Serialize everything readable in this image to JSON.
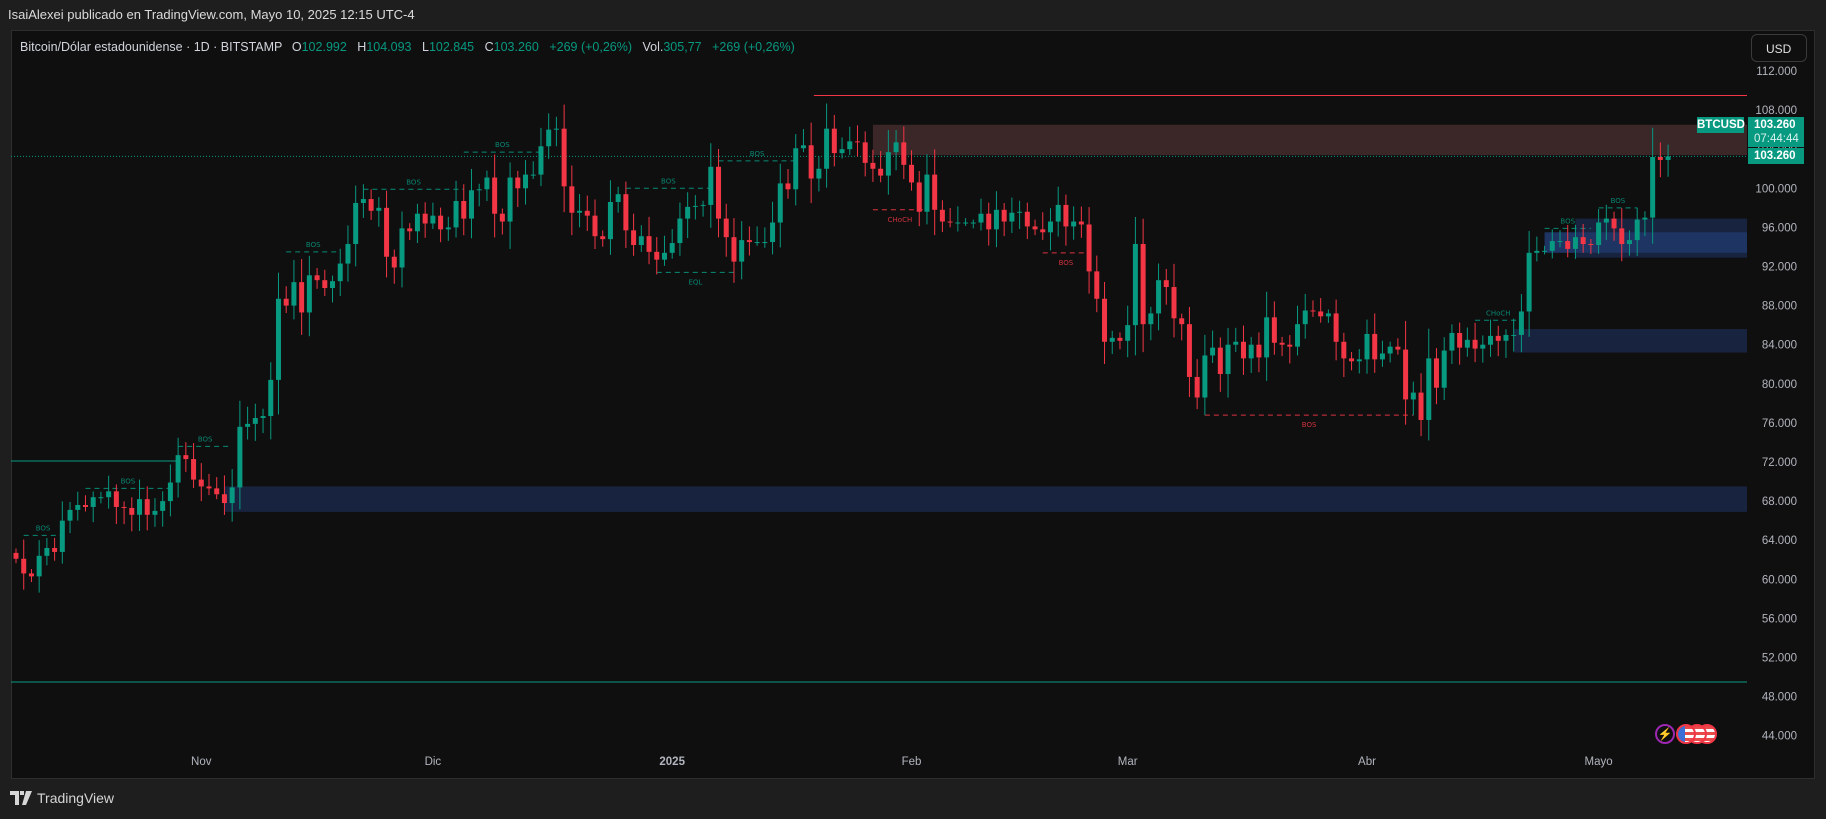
{
  "header": {
    "publisher_line": "IsaiAlexei publicado en TradingView.com, Mayo 10, 2025 12:15 UTC-4"
  },
  "legend": {
    "symbol": "Bitcoin/Dólar estadounidense · 1D · BITSTAMP",
    "o_label": "O",
    "o": "102.992",
    "h_label": "H",
    "h": "104.093",
    "l_label": "L",
    "l": "102.845",
    "c_label": "C",
    "c": "103.260",
    "change": "+269 (+0,26%)",
    "vol_label": "Vol.",
    "vol": "305,77",
    "vol_change": "+269 (+0,26%)"
  },
  "currency_button": "USD",
  "price_tag": {
    "symbol": "BTCUSD",
    "price": "103.260",
    "countdown": "07:44:44",
    "price2": "103.260"
  },
  "footer": {
    "brand": "TradingView"
  },
  "colors": {
    "up": "#089981",
    "down": "#f23645",
    "supply": "#3b2628",
    "demand": "#18243f",
    "demand_light": "#1e3462",
    "bg": "#0f0f0f"
  },
  "icons": [
    "lightning-event-icon",
    "us-flag-event-icon",
    "us-flag-event-icon",
    "us-flag-event-icon"
  ],
  "chart_data": {
    "type": "candlestick",
    "symbol": "BTCUSD",
    "interval": "1D",
    "start_date": "2024-10-08",
    "first_open": 62.7,
    "unit": "thousand USD",
    "closes": [
      62.1,
      60.6,
      60.3,
      62.4,
      63.2,
      62.8,
      66.0,
      67.1,
      67.6,
      67.4,
      68.4,
      68.4,
      69.0,
      67.4,
      67.3,
      66.6,
      68.2,
      66.6,
      67.0,
      68.0,
      69.9,
      72.7,
      72.3,
      70.2,
      69.5,
      69.3,
      68.7,
      67.8,
      69.4,
      75.6,
      75.9,
      76.5,
      76.7,
      80.4,
      88.7,
      88.0,
      90.4,
      87.3,
      91.1,
      90.6,
      89.8,
      90.5,
      92.3,
      94.3,
      98.5,
      98.9,
      97.7,
      98.0,
      93.0,
      91.9,
      95.9,
      95.6,
      97.4,
      96.4,
      97.2,
      95.8,
      96.0,
      98.7,
      96.9,
      99.8,
      99.9,
      101.1,
      97.4,
      96.6,
      101.1,
      100.0,
      101.4,
      101.4,
      104.3,
      106.0,
      106.1,
      100.2,
      97.5,
      97.7,
      97.2,
      95.1,
      94.8,
      98.6,
      99.4,
      95.7,
      94.2,
      95.1,
      93.5,
      92.7,
      93.4,
      94.4,
      96.9,
      98.1,
      98.2,
      98.3,
      102.2,
      96.9,
      95.0,
      92.5,
      94.7,
      94.5,
      94.5,
      94.5,
      96.5,
      100.5,
      99.9,
      104.1,
      104.4,
      101.0,
      102.0,
      106.1,
      103.6,
      104.0,
      104.8,
      104.7,
      102.6,
      102.0,
      101.3,
      103.7,
      104.7,
      102.4,
      100.6,
      97.6,
      101.4,
      97.8,
      96.6,
      96.5,
      96.5,
      96.5,
      96.5,
      97.4,
      95.8,
      97.8,
      96.6,
      97.5,
      97.6,
      96.1,
      95.8,
      95.5,
      96.6,
      98.3,
      96.1,
      96.6,
      96.3,
      91.5,
      88.7,
      84.3,
      84.7,
      84.4,
      86.0,
      94.3,
      86.1,
      87.2,
      90.6,
      89.9,
      86.7,
      86.1,
      80.7,
      78.6,
      82.9,
      83.7,
      81.0,
      84.0,
      84.3,
      82.6,
      84.0,
      82.7,
      86.8,
      84.2,
      84.0,
      83.8,
      86.1,
      87.5,
      87.4,
      86.9,
      87.2,
      84.3,
      82.6,
      82.3,
      82.5,
      85.1,
      82.5,
      83.1,
      83.8,
      83.5,
      78.4,
      79.1,
      76.3,
      82.6,
      79.6,
      83.4,
      85.2,
      83.7,
      84.5,
      83.6,
      84.0,
      84.9,
      84.4,
      85.0,
      85.0,
      87.4,
      93.4,
      93.6,
      93.6,
      94.6,
      94.6,
      93.8,
      95.0,
      94.3,
      94.2,
      96.5,
      96.9,
      95.9,
      94.3,
      94.7,
      96.8,
      97.0,
      103.2,
      102.9,
      103.26
    ],
    "y_ticks": [
      "112.000",
      "108.000",
      "104.000",
      "100.000",
      "96.000",
      "92.000",
      "88.000",
      "84.000",
      "80.000",
      "76.000",
      "72.000",
      "68.000",
      "64.000",
      "60.000",
      "56.000",
      "52.000",
      "48.000",
      "44.000"
    ],
    "y_tick_values": [
      112,
      108,
      104,
      100,
      96,
      92,
      88,
      84,
      80,
      76,
      72,
      68,
      64,
      60,
      56,
      52,
      48,
      44
    ],
    "ylim": [
      44,
      112
    ],
    "x_ticks": [
      {
        "label": "Nov",
        "date": "2024-11-01"
      },
      {
        "label": "Dic",
        "date": "2024-12-01"
      },
      {
        "label": "2025",
        "date": "2025-01-01"
      },
      {
        "label": "Feb",
        "date": "2025-02-01"
      },
      {
        "label": "Mar",
        "date": "2025-03-01"
      },
      {
        "label": "Abr",
        "date": "2025-04-01"
      },
      {
        "label": "Mayo",
        "date": "2025-05-01"
      }
    ],
    "last_price": 103.26,
    "zones": [
      {
        "kind": "supply",
        "from": "2025-01-27",
        "low": 103.4,
        "high": 106.5
      },
      {
        "kind": "demand",
        "from": "2025-04-28",
        "low": 92.9,
        "high": 96.9
      },
      {
        "kind": "demand_light",
        "from": "2025-04-24",
        "low": 93.4,
        "high": 95.5
      },
      {
        "kind": "demand",
        "from": "2025-04-20",
        "low": 83.2,
        "high": 85.6
      },
      {
        "kind": "demand",
        "from": "2024-11-04",
        "low": 66.9,
        "high": 69.5
      }
    ],
    "levels": [
      {
        "color": "#f23645",
        "from": "2025-01-20",
        "price": 109.5
      },
      {
        "color": "#089981",
        "from": "2024-10-08",
        "to": "2024-10-29",
        "price": 72.1
      },
      {
        "color": "#089981",
        "from": "2024-10-08",
        "price": 49.5
      }
    ],
    "structure": [
      {
        "label": "BOS",
        "dir": "up",
        "from": "2024-10-09",
        "to": "2024-10-14",
        "price": 64.5
      },
      {
        "label": "BOS",
        "dir": "up",
        "from": "2024-10-17",
        "to": "2024-10-28",
        "price": 69.3
      },
      {
        "label": "BOS",
        "dir": "up",
        "from": "2024-10-29",
        "to": "2024-11-05",
        "price": 73.6
      },
      {
        "label": "BOS",
        "dir": "up",
        "from": "2024-11-12",
        "to": "2024-11-19",
        "price": 93.5
      },
      {
        "label": "BOS",
        "dir": "up",
        "from": "2024-11-22",
        "to": "2024-12-05",
        "price": 99.9
      },
      {
        "label": "BOS",
        "dir": "up",
        "from": "2024-12-05",
        "to": "2024-12-15",
        "price": 103.7
      },
      {
        "label": "BOS",
        "dir": "up",
        "from": "2024-12-26",
        "to": "2025-01-06",
        "price": 100.0
      },
      {
        "label": "EQL",
        "dir": "eql",
        "from": "2024-12-30",
        "to": "2025-01-09",
        "price": 91.4
      },
      {
        "label": "BOS",
        "dir": "up",
        "from": "2025-01-07",
        "to": "2025-01-17",
        "price": 102.8
      },
      {
        "label": "CHoCH",
        "dir": "down",
        "from": "2025-01-27",
        "to": "2025-02-03",
        "price": 97.8
      },
      {
        "label": "BOS",
        "dir": "down",
        "from": "2025-02-18",
        "to": "2025-02-24",
        "price": 93.4
      },
      {
        "label": "BOS",
        "dir": "down",
        "from": "2025-03-11",
        "to": "2025-04-07",
        "price": 76.8
      },
      {
        "label": "CHoCH",
        "dir": "up",
        "from": "2025-04-15",
        "to": "2025-04-21",
        "price": 86.5
      },
      {
        "label": "BOS",
        "dir": "up",
        "from": "2025-04-24",
        "to": "2025-04-30",
        "price": 95.9
      },
      {
        "label": "BOS",
        "dir": "up",
        "from": "2025-05-01",
        "to": "2025-05-06",
        "price": 98.0
      }
    ]
  }
}
